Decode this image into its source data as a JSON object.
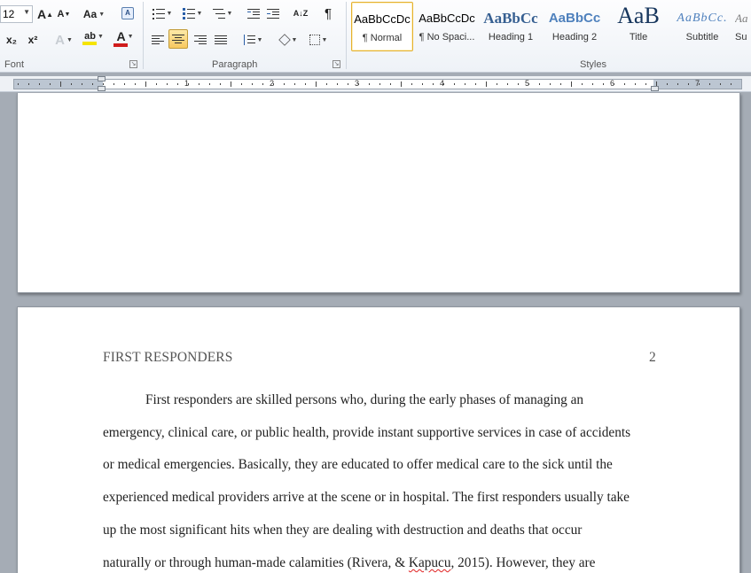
{
  "ribbon": {
    "font_group": {
      "label": "Font",
      "font_size": "12",
      "grow_label": "A",
      "shrink_label": "A",
      "change_case_label": "Aa",
      "subscript_label": "x₂",
      "superscript_label": "x²",
      "text_effects_label": "A",
      "highlight_label": "ab",
      "font_color_label": "A",
      "highlight_color": "#f5e400",
      "font_color": "#d01c1c"
    },
    "paragraph_group": {
      "label": "Paragraph",
      "show_marks_label": "¶",
      "sort_label": "A↓Z"
    },
    "styles_group": {
      "label": "Styles",
      "items": [
        {
          "sample": "AaBbCcDc",
          "name": "¶ Normal"
        },
        {
          "sample": "AaBbCcDc",
          "name": "¶ No Spaci..."
        },
        {
          "sample": "AaBbCc",
          "name": "Heading 1"
        },
        {
          "sample": "AaBbCc",
          "name": "Heading 2"
        },
        {
          "sample": "AaB",
          "name": "Title"
        },
        {
          "sample": "AaBbCc.",
          "name": "Subtitle"
        },
        {
          "sample": "Aa",
          "name": "Su"
        }
      ]
    }
  },
  "ruler": {
    "numbers": [
      "1",
      "2",
      "3",
      "4",
      "5",
      "6",
      "7"
    ]
  },
  "document": {
    "header": {
      "title": "FIRST RESPONDERS",
      "page_number": "2"
    },
    "lines": [
      "First responders are skilled persons who, during the early phases of managing an",
      "emergency, clinical care, or public health, provide instant supportive services in case of accidents",
      "or medical emergencies.  Basically,  they are educated to offer medical care to the sick until the",
      "experienced medical providers arrive at the scene or in hospital. The first responders usually take",
      "up the most significant hits when they are dealing with destruction and deaths that occur"
    ],
    "last_line": {
      "before": "naturally or through human-made calamities (Rivera, & ",
      "misspelled": "Kapucu",
      "after": ", 2015). However, they are"
    }
  }
}
